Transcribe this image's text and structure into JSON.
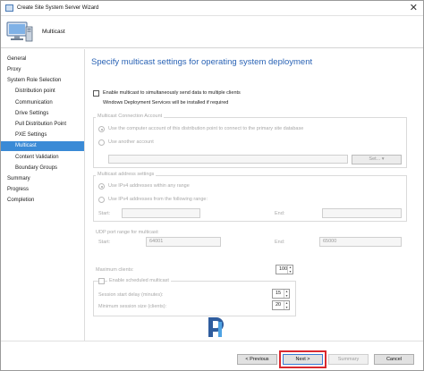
{
  "window": {
    "title": "Create Site System Server Wizard",
    "close_glyph": "✕"
  },
  "header": {
    "title": "Multicast"
  },
  "nav": {
    "items": [
      {
        "label": "General",
        "selected": false
      },
      {
        "label": "Proxy",
        "selected": false
      },
      {
        "label": "System Role Selection",
        "selected": false
      },
      {
        "label": "Distribution point",
        "selected": false
      },
      {
        "label": "Communication",
        "selected": false
      },
      {
        "label": "Drive Settings",
        "selected": false
      },
      {
        "label": "Pull Distribution Point",
        "selected": false
      },
      {
        "label": "PXE Settings",
        "selected": false
      },
      {
        "label": "Multicast",
        "selected": true
      },
      {
        "label": "Content Validation",
        "selected": false
      },
      {
        "label": "Boundary Groups",
        "selected": false
      },
      {
        "label": "Summary",
        "selected": false
      },
      {
        "label": "Progress",
        "selected": false
      },
      {
        "label": "Completion",
        "selected": false
      }
    ]
  },
  "main": {
    "title": "Specify multicast settings for operating system deployment",
    "enable_multicast": {
      "label": "Enable multicast to simultaneously send data to multiple clients",
      "checked": false
    },
    "wds_note": "Windows Deployment Services will be installed if required",
    "connection_account": {
      "group_title": "Multicast Connection Account",
      "option1": "Use the computer account of this distribution point to connect to the primary site database",
      "option2": "Use another account",
      "set_button": "Set...",
      "set_arrow": "▾"
    },
    "address_settings": {
      "group_title": "Multicast address settings",
      "option1": "Use IPv4 addresses within any range",
      "option2": "Use IPv4 addresses from the following range:",
      "start_label": "Start:",
      "end_label": "End:"
    },
    "udp": {
      "group_title": "UDP port range for multicast:",
      "start_label": "Start:",
      "start_value": "64001",
      "end_label": "End:",
      "end_value": "65000"
    },
    "max_clients": {
      "label": "Maximum clients:",
      "value": "100"
    },
    "scheduled": {
      "label": "Enable scheduled multicast",
      "checked": false,
      "delay_label": "Session start delay (minutes):",
      "delay_value": "15",
      "min_size_label": "Minimum session size (clients):",
      "min_size_value": "20"
    }
  },
  "footer": {
    "previous": "< Previous",
    "next": "Next >",
    "summary": "Summary",
    "cancel": "Cancel"
  },
  "colors": {
    "accent": "#3a8ad6",
    "title_blue": "#2a63b5",
    "highlight": "#d9282f"
  }
}
